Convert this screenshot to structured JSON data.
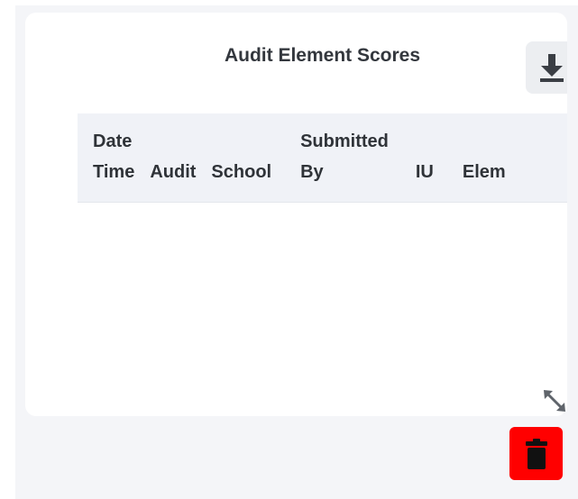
{
  "widget": {
    "title": "Audit Element Scores",
    "download_icon": "download-icon",
    "columns": [
      {
        "line1": "Date",
        "line2": "Time"
      },
      {
        "line1": "",
        "line2": "Audit"
      },
      {
        "line1": "",
        "line2": "School"
      },
      {
        "line1": "Submitted",
        "line2": "By"
      },
      {
        "line1": "",
        "line2": "IU"
      },
      {
        "line1": "",
        "line2": "Elem"
      }
    ],
    "resize_icon": "resize-diagonal-icon",
    "delete_icon": "trash-icon"
  },
  "colors": {
    "delete_button": "#ff0000",
    "card_background": "#ffffff",
    "header_background": "#f0f2f7",
    "canvas_background": "#f4f5f8"
  }
}
